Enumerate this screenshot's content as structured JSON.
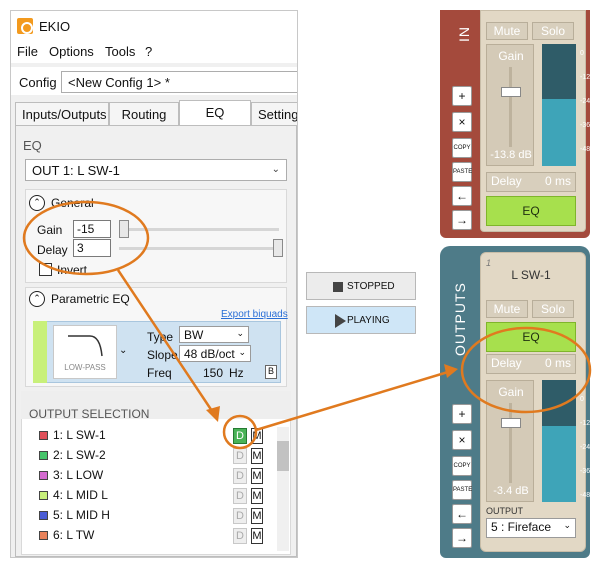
{
  "app": {
    "title": "EKIO"
  },
  "menu": [
    "File",
    "Options",
    "Tools",
    "?"
  ],
  "config": {
    "label": "Config",
    "value": "<New Config 1> *"
  },
  "tabs": [
    "Inputs/Outputs",
    "Routing",
    "EQ",
    "Settings"
  ],
  "eq": {
    "section_label": "EQ",
    "output_select": "OUT 1: L SW-1",
    "general": {
      "title": "General",
      "gain_label": "Gain",
      "gain_value": "-15",
      "delay_label": "Delay",
      "delay_value": "3",
      "invert_label": "Invert"
    },
    "parametric": {
      "title": "Parametric EQ",
      "export_link": "Export biquads",
      "filter_name": "LOW-PASS",
      "type_label": "Type",
      "type_value": "BW",
      "slope_label": "Slope",
      "slope_value": "48 dB/oct",
      "freq_label": "Freq",
      "freq_value": "150",
      "freq_unit": "Hz",
      "bypass": "B"
    }
  },
  "output_selection": {
    "title": "OUTPUT SELECTION",
    "rows": [
      {
        "label": "1: L SW-1",
        "color": "#e0505a",
        "d_active": true
      },
      {
        "label": "2: L SW-2",
        "color": "#46c46a",
        "d_active": false
      },
      {
        "label": "3: L LOW",
        "color": "#d46ad0",
        "d_active": false
      },
      {
        "label": "4: L MID L",
        "color": "#c8f07a",
        "d_active": false
      },
      {
        "label": "5: L MID H",
        "color": "#4a5cd6",
        "d_active": false
      },
      {
        "label": "6: L TW",
        "color": "#e8825a",
        "d_active": false
      }
    ],
    "d_label": "D",
    "m_label": "M"
  },
  "transport": {
    "stopped": "STOPPED",
    "playing": "PLAYING"
  },
  "mixer": {
    "inputs_label": "IN",
    "outputs_label": "OUTPUTS",
    "side_buttons": [
      "+",
      "×",
      "COPY",
      "PASTE",
      "←",
      "→"
    ],
    "top_channel": {
      "mute": "Mute",
      "solo": "Solo",
      "gain_label": "Gain",
      "gain_value": "-13.8 dB",
      "delay_label": "Delay",
      "delay_value": "0 ms",
      "eq": "EQ",
      "fader_level": 0.72,
      "meter_level": 0.55
    },
    "bottom_channel": {
      "number": "1",
      "name": "L SW-1",
      "mute": "Mute",
      "solo": "Solo",
      "eq": "EQ",
      "delay_label": "Delay",
      "delay_value": "0 ms",
      "gain_label": "Gain",
      "gain_value": "-3.4 dB",
      "output_label": "OUTPUT",
      "output_value": "5 : Fireface",
      "fader_level": 0.78,
      "meter_level": 0.62
    },
    "meter_ticks": [
      "0",
      "-12",
      "-24",
      "-36",
      "-48"
    ]
  },
  "colors": {
    "accent_orange": "#e07a1f",
    "eq_green": "#a7e04d",
    "red_strip": "#a44a3c",
    "blue_strip": "#4e7b88"
  }
}
